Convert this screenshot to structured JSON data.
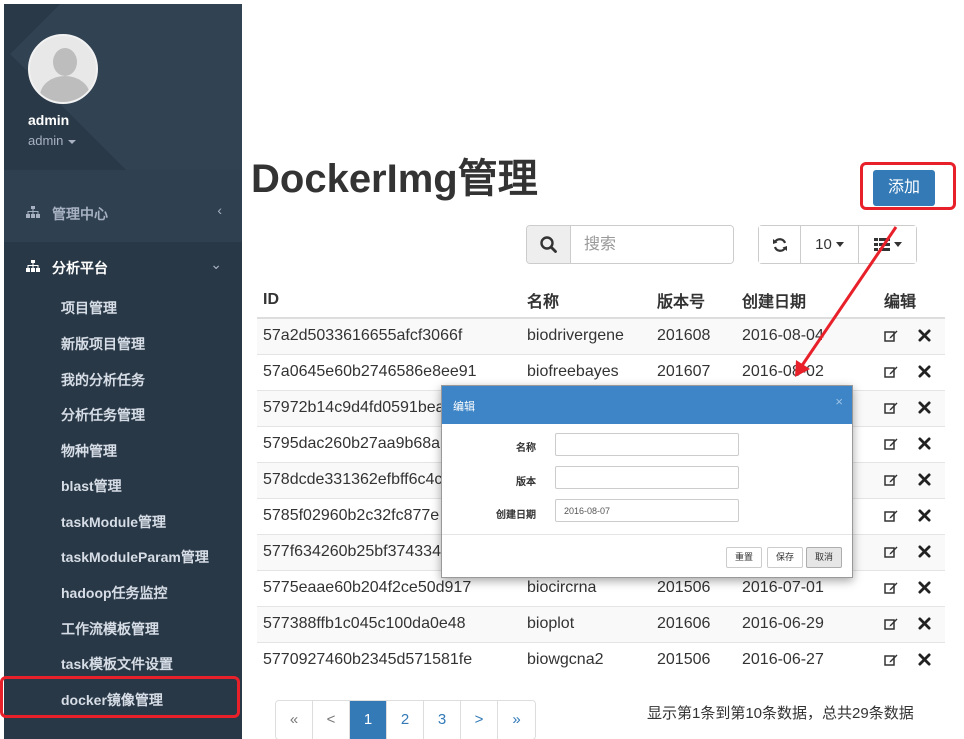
{
  "colors": {
    "accent": "#337ab7",
    "sidebar": "#2f4050",
    "highlight": "#e8202a",
    "modal_header": "#3d85c6"
  },
  "sidebar": {
    "user_name": "admin",
    "user_role": "admin",
    "avatar_icon": "user-avatar-icon",
    "groups": [
      {
        "label": "管理中心",
        "icon": "sitemap-icon",
        "arrow": "‹"
      },
      {
        "label": "分析平台",
        "icon": "sitemap-icon",
        "arrow": "⌄"
      }
    ],
    "items": [
      {
        "label": "项目管理"
      },
      {
        "label": "新版项目管理"
      },
      {
        "label": "我的分析任务"
      },
      {
        "label": "分析任务管理"
      },
      {
        "label": "物种管理"
      },
      {
        "label": "blast管理"
      },
      {
        "label": "taskModule管理"
      },
      {
        "label": "taskModuleParam管理"
      },
      {
        "label": "hadoop任务监控"
      },
      {
        "label": "工作流模板管理"
      },
      {
        "label": "task模板文件设置"
      },
      {
        "label": "docker镜像管理"
      }
    ]
  },
  "main": {
    "title": "DockerImg管理",
    "add_label": "添加",
    "search": {
      "placeholder": "搜索"
    },
    "page_size": "10"
  },
  "table": {
    "columns": [
      "ID",
      "名称",
      "版本号",
      "创建日期",
      "编辑"
    ],
    "rows": [
      {
        "id": "57a2d5033616655afcf3066f",
        "name": "biodrivergene",
        "version": "201608",
        "date": "2016-08-04"
      },
      {
        "id": "57a0645e60b2746586e8ee91",
        "name": "biofreebayes",
        "version": "201607",
        "date": "2016-08-02"
      },
      {
        "id": "57972b14c9d4fd0591bea",
        "name": "",
        "version": "",
        "date": ""
      },
      {
        "id": "5795dac260b27aa9b68a",
        "name": "",
        "version": "",
        "date": ""
      },
      {
        "id": "578dcde331362efbff6c4c",
        "name": "",
        "version": "",
        "date": ""
      },
      {
        "id": "5785f02960b2c32fc877e",
        "name": "",
        "version": "",
        "date": ""
      },
      {
        "id": "577f634260b25bf374334",
        "name": "",
        "version": "",
        "date": ""
      },
      {
        "id": "5775eaae60b204f2ce50d917",
        "name": "biocircrna",
        "version": "201506",
        "date": "2016-07-01"
      },
      {
        "id": "577388ffb1c045c100da0e48",
        "name": "bioplot",
        "version": "201606",
        "date": "2016-06-29"
      },
      {
        "id": "5770927460b2345d571581fe",
        "name": "biowgcna2",
        "version": "201506",
        "date": "2016-06-27"
      }
    ]
  },
  "pagination": {
    "first": "«",
    "prev": "<",
    "pages": [
      "1",
      "2",
      "3"
    ],
    "next": ">",
    "last": "»",
    "current": "1",
    "info": "显示第1条到第10条数据，总共29条数据"
  },
  "modal": {
    "title": "编辑",
    "close": "×",
    "fields": [
      {
        "label": "名称",
        "value": ""
      },
      {
        "label": "版本",
        "value": ""
      },
      {
        "label": "创建日期",
        "value": "2016-08-07"
      }
    ],
    "buttons": {
      "reset": "重置",
      "save": "保存",
      "cancel": "取消"
    }
  }
}
